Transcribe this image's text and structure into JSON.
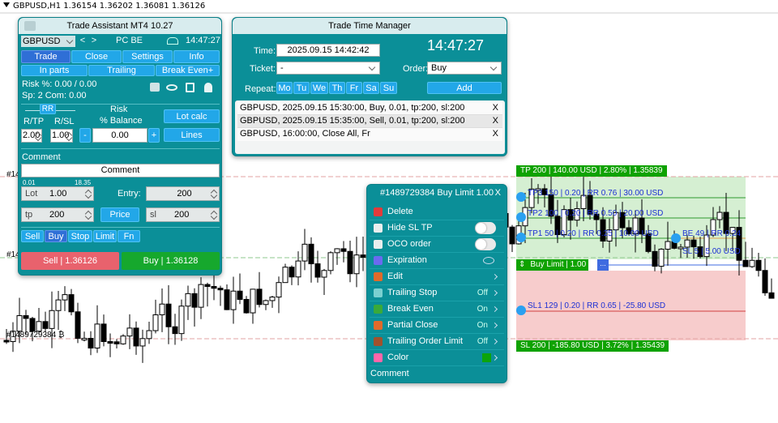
{
  "chart": {
    "symbol_label": "GBPUSD,H1  1.36154 1.36202 1.36081 1.36126",
    "left_labels": [
      "#1489729384 ₿",
      "#14",
      "#14"
    ],
    "colors": {
      "bull": "#000000",
      "bear": "#ffffff",
      "tp_zone": "#d5efd2",
      "sl_zone": "#f7cccc",
      "tp_line": "#2f9a2f",
      "sl_line": "#d04040",
      "accent": "#0b8f98"
    }
  },
  "trade_assistant": {
    "title": "Trade Assistant MT4 10.27",
    "symbol": "GBPUSD",
    "prev": "<",
    "next": ">",
    "account": "PC BE",
    "time": "14:47:27",
    "tabs": [
      "Trade",
      "Close",
      "Settings",
      "Info"
    ],
    "subtabs": [
      "In parts",
      "Trailing",
      "Break Even+"
    ],
    "risk_line": "Risk %: 0.00 /  0.00",
    "sp_line": "Sp: 2  Com: 0.00",
    "rr_label": "RR",
    "rtp_label": "R/TP",
    "rsl_label": "R/SL",
    "rtp_value": "2.00",
    "rsl_value": "1.00",
    "risk_label": "Risk",
    "balance_label": "% Balance",
    "minus": "-",
    "plus": "+",
    "risk_value": "0.00",
    "lot_calc": "Lot calc",
    "lines": "Lines",
    "comment_label": "Comment",
    "comment_value": "Comment",
    "lot_min": "0.01",
    "lot_max": "18.35",
    "lot_label": "Lot",
    "lot_value": "1.00",
    "entry_label": "Entry:",
    "entry_value": "200",
    "tp_label": "tp",
    "tp_value": "200",
    "price_btn": "Price",
    "sl_label": "sl",
    "sl_value": "200",
    "order_types": [
      "Sell",
      "Buy",
      "Stop",
      "Limit",
      "Fn"
    ],
    "sell_btn": "Sell  | 1.36126",
    "buy_btn": "Buy  | 1.36128"
  },
  "time_manager": {
    "title": "Trade Time Manager",
    "time_label": "Time:",
    "time_value": "2025.09.15 14:42:42",
    "clock": "14:47:27",
    "ticket_label": "Ticket:",
    "ticket_value": "-",
    "order_label": "Order:",
    "order_value": "Buy",
    "repeat_label": "Repeat:",
    "days": [
      "Mo",
      "Tu",
      "We",
      "Th",
      "Fr",
      "Sa",
      "Su"
    ],
    "add_btn": "Add",
    "schedule": [
      {
        "text": "GBPUSD, 2025.09.15 15:30:00, Buy, 0.01, tp:200, sl:200",
        "x": "X"
      },
      {
        "text": "GBPUSD, 2025.09.15 15:35:00, Sell, 0.01, tp:200, sl:200",
        "x": "X"
      },
      {
        "text": "GBPUSD, 16:00:00, Close All, Fr",
        "x": "X"
      }
    ]
  },
  "order_menu": {
    "title": "#1489729384 Buy Limit 1.00",
    "close": "X",
    "items": [
      {
        "label": "Delete",
        "status": "",
        "icon": "delete-icon"
      },
      {
        "label": "Hide SL TP",
        "status": "",
        "icon": "hide-sltp-icon"
      },
      {
        "label": "OCO order",
        "status": "",
        "icon": "oco-icon"
      },
      {
        "label": "Expiration",
        "status": "",
        "icon": "hourglass-icon"
      },
      {
        "label": "Edit",
        "status": "",
        "icon": "edit-icon"
      },
      {
        "label": "Trailing Stop",
        "status": "Off",
        "icon": "trailing-stop-icon"
      },
      {
        "label": "Break Even",
        "status": "On",
        "icon": "shield-icon"
      },
      {
        "label": "Partial Close",
        "status": "On",
        "icon": "partial-close-icon"
      },
      {
        "label": "Trailing Order Limit",
        "status": "Off",
        "icon": "trailing-limit-icon"
      },
      {
        "label": "Color",
        "status": "",
        "icon": "color-wheel-icon"
      }
    ],
    "comment": "Comment"
  },
  "levels": {
    "tp_header": "TP 200 | 140.00 USD | 2.80% | 1.35839",
    "tp3": "TP3 150 | 0.20 | RR 0.76 | 30.00 USD",
    "tp2": "TP2 100 | 0.20 | RR 0.50 | 20.00 USD",
    "tp1": "TP1 50 | 0.20 | RR 0.25 | 10.00 USD",
    "be": "BE 49 | RR 0.24",
    "sl5": "SL 5 | 5.00 USD",
    "buy_limit": "Buy Limit | 1.00",
    "buy_limit_more": "...",
    "sl1": "SL1 129 | 0.20 | RR 0.65 | -25.80 USD",
    "sl_footer": "SL 200 | -185.80 USD | 3.72% | 1.35439"
  }
}
